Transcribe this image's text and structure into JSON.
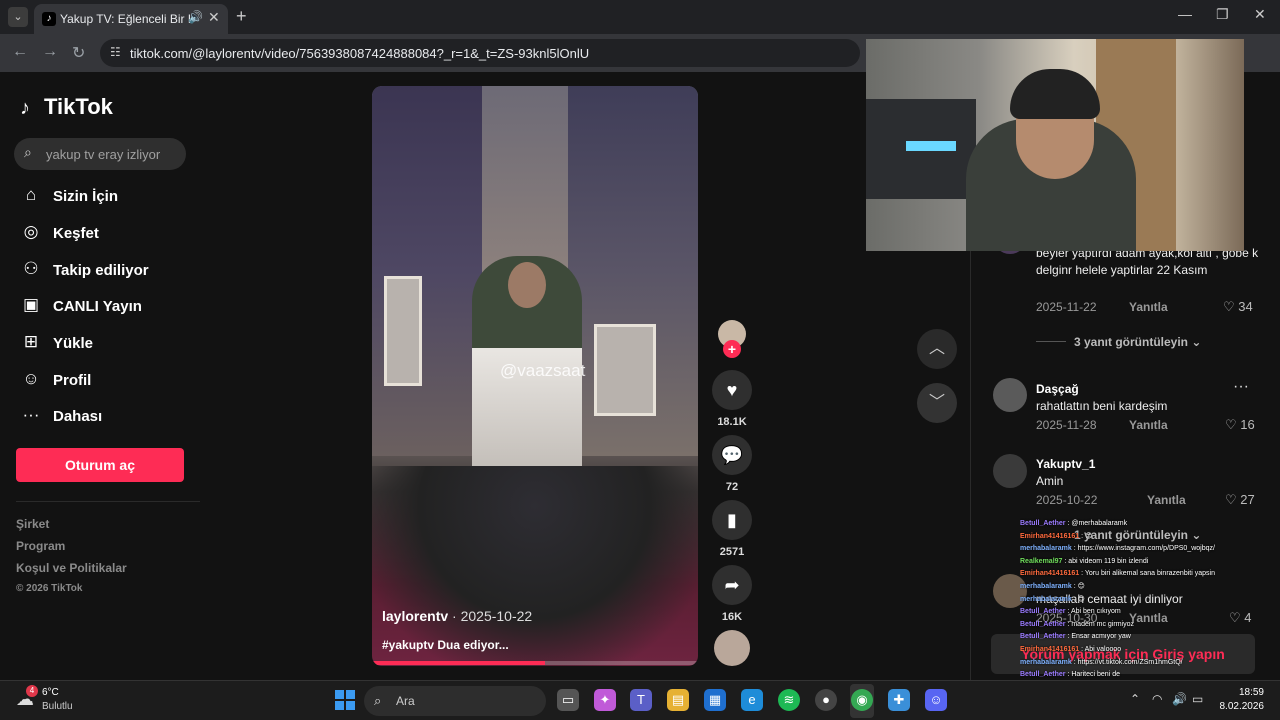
{
  "browser": {
    "tab_title": "Yakup TV: Eğlenceli Bir Hay",
    "url": "tiktok.com/@laylorentv/video/7563938087424888084?_r=1&_t=ZS-93knl5lOnlU"
  },
  "sidebar": {
    "logo": "TikTok",
    "search_placeholder": "yakup tv eray izliyor",
    "items": [
      {
        "label": "Sizin İçin",
        "icon": "home-icon"
      },
      {
        "label": "Keşfet",
        "icon": "compass-icon"
      },
      {
        "label": "Takip ediliyor",
        "icon": "following-icon"
      },
      {
        "label": "CANLI Yayın",
        "icon": "live-icon"
      },
      {
        "label": "Yükle",
        "icon": "upload-icon"
      },
      {
        "label": "Profil",
        "icon": "profile-icon"
      },
      {
        "label": "Dahası",
        "icon": "more-icon"
      }
    ],
    "login_label": "Oturum aç",
    "footer": [
      "Şirket",
      "Program",
      "Koşul ve Politikalar",
      "© 2026 TikTok"
    ]
  },
  "video": {
    "watermark": "@vaazsaat",
    "author": "laylorentv",
    "date": "· 2025-10-22",
    "caption": "#yakuptv Dua ediyor...",
    "progress": 0.53,
    "likes": "18.1K",
    "comments": "72",
    "saves": "2571",
    "shares": "16K"
  },
  "comments": {
    "items": [
      {
        "text": "beyler yaptırdı adam ayak,kol altı , göbe k delginr helele yaptirlar 22 Kasım",
        "date": "2025-11-22",
        "reply": "Yanıtla",
        "likes": "34",
        "view_replies": "3 yanıt görüntüleyin"
      },
      {
        "user": "Daşçağ",
        "text": "rahatlattın beni kardeşim",
        "date": "2025-11-28",
        "reply": "Yanıtla",
        "likes": "16"
      },
      {
        "user": "Yakuptv_1",
        "text": "Amin",
        "date": "2025-10-22",
        "reply": "Yanıtla",
        "likes": "27",
        "view_replies": "1 yanıt görüntüleyin"
      },
      {
        "text": "maşallah cemaat iyi dinliyor",
        "date": "2025-10-30",
        "reply": "Yanıtla",
        "likes": "4"
      }
    ],
    "login_prompt": "Yorum yapmak için Giriş yapın"
  },
  "chat": [
    {
      "user": "Betull_Aether",
      "color": "#9b7bff",
      "msg": ": @merhabalaramk"
    },
    {
      "user": "Emirhan41416161",
      "color": "#ff6a3d",
      "msg": ": 😊"
    },
    {
      "user": "merhabalaramk",
      "color": "#7fb2ff",
      "msg": ": https://www.instagram.com/p/DPS0_wojbqz/"
    },
    {
      "user": "Realkemal97",
      "color": "#6fdc5b",
      "msg": ": abi videom 119 bin izlendi"
    },
    {
      "user": "Emirhan41416161",
      "color": "#ff6a3d",
      "msg": ": Yoru biri alikemal sana binrazenbiti yapsin"
    },
    {
      "user": "merhabalaramk",
      "color": "#7fb2ff",
      "msg": ": 😊"
    },
    {
      "user": "merhabalaramk",
      "color": "#7fb2ff",
      "msg": ": 😊"
    },
    {
      "user": "Betull_Aether",
      "color": "#9b7bff",
      "msg": ": Abi ben cıkıyom"
    },
    {
      "user": "Betull_Aether",
      "color": "#9b7bff",
      "msg": ": madem mc girmiyoz"
    },
    {
      "user": "Betull_Aether",
      "color": "#9b7bff",
      "msg": ": Ensar acmıyor yaw"
    },
    {
      "user": "Emirhan41416161",
      "color": "#ff6a3d",
      "msg": ": Abi valoooo"
    },
    {
      "user": "merhabalaramk",
      "color": "#7fb2ff",
      "msg": ": https://vt.tiktok.com/ZSm1hmGtQ/"
    },
    {
      "user": "Betull_Aether",
      "color": "#9b7bff",
      "msg": ": Hariteci beni de"
    },
    {
      "user": "Realkemal97",
      "color": "#6fdc5b",
      "msg": ": 😊"
    },
    {
      "user": "merhabalaramk",
      "color": "#7fb2ff",
      "msg": ": 😊"
    }
  ],
  "taskbar": {
    "weather_badge": "4",
    "temperature": "6°C",
    "condition": "Bulutlu",
    "search_label": "Ara",
    "time": "18:59",
    "date": "8.02.2026"
  },
  "colors": {
    "accent": "#fe2c55",
    "background": "#121212"
  }
}
